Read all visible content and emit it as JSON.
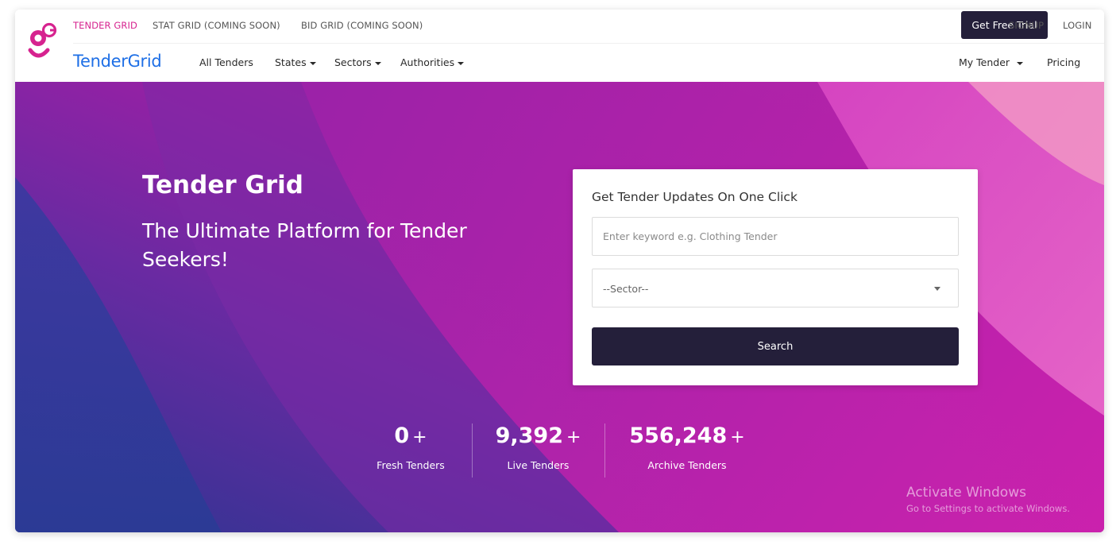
{
  "colors": {
    "accent_pink": "#d6238f",
    "brand_blue": "#1e6fe6",
    "dark_button": "#241f3a",
    "hero_gradient": [
      "#3d2a8f",
      "#8a25a6",
      "#c41aa4",
      "#e85cc4"
    ]
  },
  "topbar": {
    "links": [
      {
        "label": "TENDER GRID",
        "active": true
      },
      {
        "label": "STAT GRID (COMING SOON)",
        "active": false
      },
      {
        "label": "BID GRID (COMING SOON)",
        "active": false
      }
    ],
    "trial_button": "Get Free Trial",
    "signup": "SIGNUP",
    "login": "LOGIN"
  },
  "nav": {
    "logo_icon": "tendergrid-logo-icon",
    "brand": "TenderGrid",
    "links": [
      "All Tenders",
      "States",
      "Sectors",
      "Authorities"
    ],
    "my_tender": "My Tender",
    "pricing": "Pricing"
  },
  "hero": {
    "title": "Tender Grid",
    "subtitle": "The Ultimate Platform for Tender Seekers!"
  },
  "search_card": {
    "title": "Get Tender Updates On One Click",
    "keyword_placeholder": "Enter keyword e.g. Clothing Tender",
    "keyword_value": "",
    "sector_selected": "--Sector--",
    "search_button": "Search"
  },
  "stats": [
    {
      "value": "0",
      "suffix": "+",
      "label": "Fresh Tenders"
    },
    {
      "value": "9,392",
      "suffix": "+",
      "label": "Live Tenders"
    },
    {
      "value": "556,248",
      "suffix": "+",
      "label": "Archive Tenders"
    }
  ],
  "watermark": {
    "title": "Activate Windows",
    "subtitle": "Go to Settings to activate Windows."
  }
}
